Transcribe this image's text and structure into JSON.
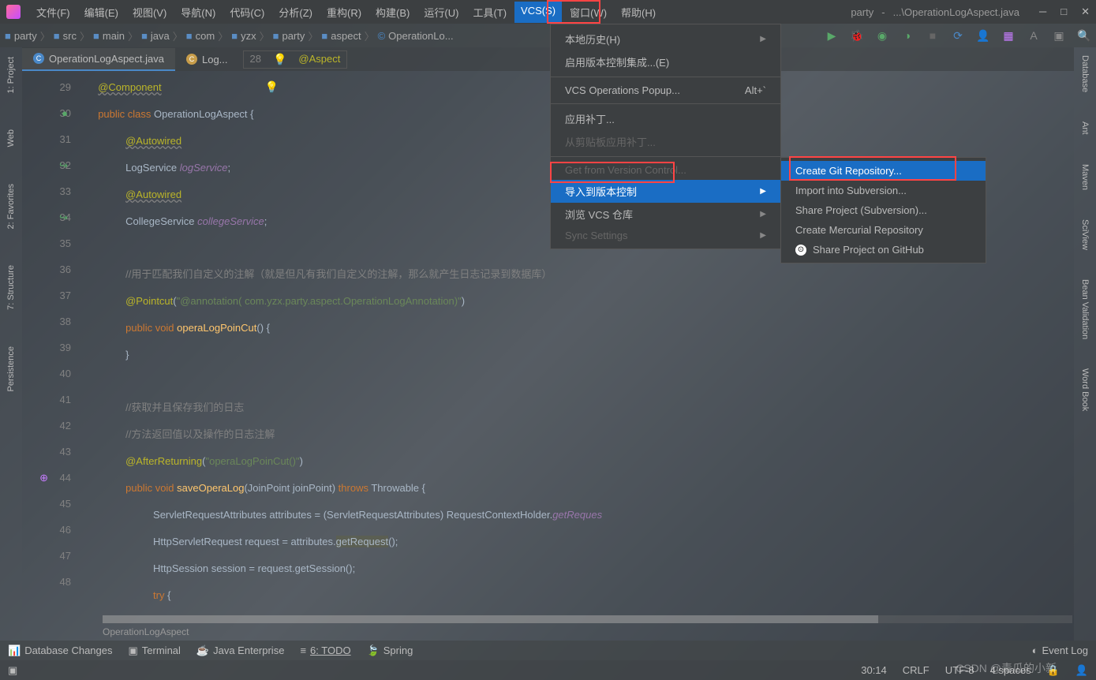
{
  "title": {
    "project": "party",
    "path": "...\\OperationLogAspect.java"
  },
  "menus": [
    "文件(F)",
    "编辑(E)",
    "视图(V)",
    "导航(N)",
    "代码(C)",
    "分析(Z)",
    "重构(R)",
    "构建(B)",
    "运行(U)",
    "工具(T)",
    "VCS(S)",
    "窗口(W)",
    "帮助(H)"
  ],
  "breadcrumb": [
    "party",
    "src",
    "main",
    "java",
    "com",
    "yzx",
    "party",
    "aspect",
    "OperationLo..."
  ],
  "tabs": [
    {
      "name": "OperationLogAspect.java",
      "active": true
    },
    {
      "name": "Log..."
    }
  ],
  "codeHint": {
    "lineno": "28",
    "text": "@Aspect"
  },
  "dropdown": [
    {
      "label": "本地历史(H)",
      "arrow": true
    },
    {
      "label": "启用版本控制集成...(E)"
    },
    {
      "sep": true
    },
    {
      "label": "VCS Operations Popup...",
      "shortcut": "Alt+`"
    },
    {
      "sep": true
    },
    {
      "label": "应用补丁..."
    },
    {
      "label": "从剪贴板应用补丁...",
      "disabled": true
    },
    {
      "sep": true
    },
    {
      "label": "Get from Version Control...",
      "disabled": true
    },
    {
      "label": "导入到版本控制",
      "arrow": true,
      "highlight": true
    },
    {
      "label": "浏览 VCS 仓库",
      "arrow": true
    },
    {
      "label": "Sync Settings",
      "arrow": true,
      "disabled": true
    }
  ],
  "submenu": [
    {
      "label": "Create Git Repository...",
      "highlight": true
    },
    {
      "label": "Import into Subversion..."
    },
    {
      "label": "Share Project (Subversion)..."
    },
    {
      "label": "Create Mercurial Repository"
    },
    {
      "label": "Share Project on GitHub",
      "icon": "github"
    }
  ],
  "lineNumbers": [
    29,
    30,
    31,
    32,
    33,
    34,
    35,
    36,
    37,
    38,
    39,
    40,
    41,
    42,
    43,
    44,
    45,
    46,
    47,
    48
  ],
  "code": {
    "l29": "@Component",
    "l30a": "public ",
    "l30b": "class ",
    "l30c": "OperationLogAspect ",
    "l30d": "{",
    "l31": "@Autowired",
    "l32a": "LogService ",
    "l32b": "logService",
    "l32c": ";",
    "l33": "@Autowired",
    "l34a": "CollegeService ",
    "l34b": "collegeService",
    "l34c": ";",
    "l36": "//用于匹配我们自定义的注解（就是但凡有我们自定义的注解，那么就产生日志记录到数据库）",
    "l37a": "@Pointcut",
    "l37b": "(",
    "l37c": "\"@annotation( com.yzx.party.aspect.OperationLogAnnotation)\"",
    "l37d": ")",
    "l38a": "public ",
    "l38b": "void ",
    "l38c": "operaLogPoinCut",
    "l38d": "() {",
    "l39": "}",
    "l41": "//获取并且保存我们的日志",
    "l42": "//方法返回值以及操作的日志注解",
    "l43a": "@AfterReturning",
    "l43b": "(",
    "l43c": "\"operaLogPoinCut()\"",
    "l43d": ")",
    "l44a": "public ",
    "l44b": "void ",
    "l44c": "saveOperaLog",
    "l44d": "(JoinPoint joinPoint) ",
    "l44e": "throws ",
    "l44f": "Throwable ",
    "l44g": "{",
    "l45a": "ServletRequestAttributes attributes = (ServletRequestAttributes) RequestContextHolder.",
    "l45b": "getReques",
    "l46a": "HttpServletRequest request = attributes.",
    "l46b": "getRequest",
    "l46c": "();",
    "l47": "HttpSession session = request.getSession();",
    "l48a": "try ",
    "l48b": "{"
  },
  "breadcrumb2": "OperationLogAspect",
  "bottomTabs": [
    "Database Changes",
    "Terminal",
    "Java Enterprise",
    "6: TODO",
    "Spring"
  ],
  "statusRight": [
    "Event Log"
  ],
  "status2": {
    "pos": "30:14",
    "enc": "CRLF",
    "charset": "UTF-8",
    "indent": "4 spaces",
    "lock": "🔒"
  },
  "sideLeft": [
    "1: Project",
    "Web",
    "2: Favorites",
    "7: Structure",
    "Persistence"
  ],
  "sideRight": [
    "Database",
    "Ant",
    "Maven",
    "SciView",
    "Bean Validation",
    "Word Book"
  ],
  "watermark": "CSDN @毒瓜的小新"
}
